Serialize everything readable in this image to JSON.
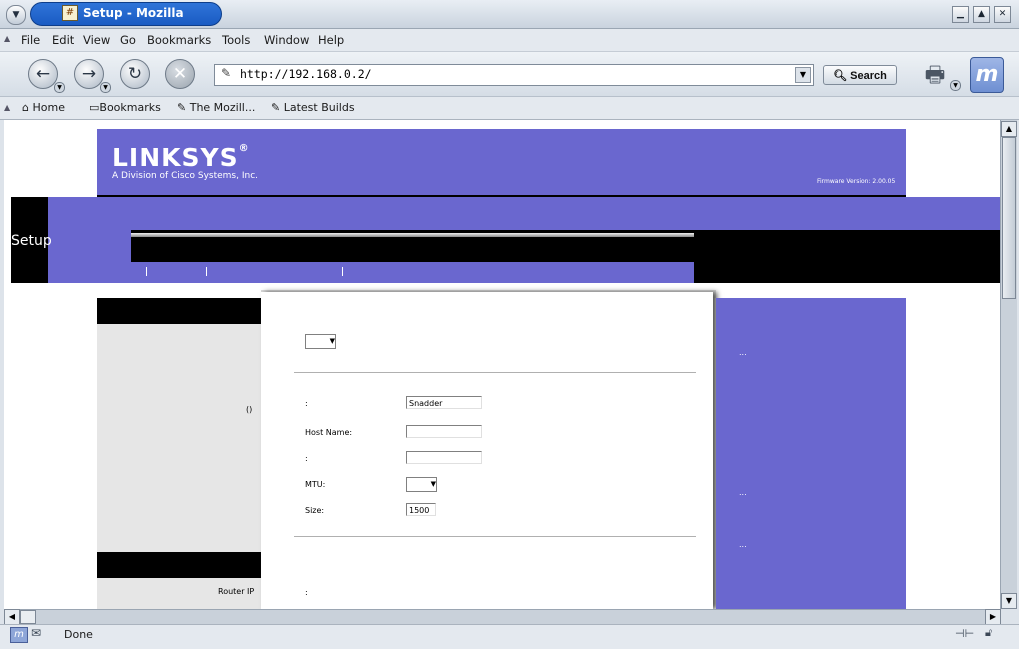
{
  "window": {
    "title": "Setup - Mozilla"
  },
  "menu": [
    "File",
    "Edit",
    "View",
    "Go",
    "Bookmarks",
    "Tools",
    "Window",
    "Help"
  ],
  "nav": {
    "url": "http://192.168.0.2/",
    "search_label": "Search"
  },
  "bookmarks": [
    "Home",
    "Bookmarks",
    "The Mozill...",
    "Latest Builds"
  ],
  "page": {
    "logo": "LINKSYS",
    "logo_reg": "®",
    "logo_sub": "A Division of Cisco Systems, Inc.",
    "firmware": "Firmware Version: 2.00.05",
    "section_title": "Setup",
    "paren_label": "()",
    "colon_label_1": ":",
    "host_name_label": "Host Name:",
    "colon_label_2": ":",
    "mtu_label": "MTU:",
    "size_label": "Size:",
    "name_value": "Snadder",
    "size_value": "1500",
    "router_ip_label": "Router IP",
    "router_ip_colon": ":",
    "ellipsis": [
      "...",
      "...",
      "..."
    ],
    "colors": {
      "brand": "#6a67cf",
      "dark": "#000000",
      "panel": "#e6e6e6"
    }
  },
  "status": {
    "text": "Done"
  }
}
